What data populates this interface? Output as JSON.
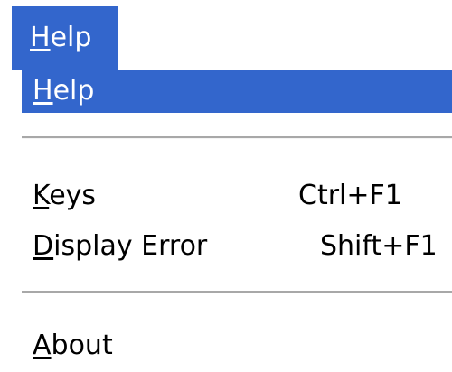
{
  "theme": {
    "selection_bg": "#3366cc",
    "selection_fg": "#ffffff",
    "text": "#000000",
    "separator": "#a8a8a8"
  },
  "menubar": {
    "help": {
      "mnemonic": "H",
      "rest": "elp"
    }
  },
  "menu": {
    "items": [
      {
        "mnemonic": "H",
        "rest": "elp",
        "shortcut": "",
        "selected": true
      },
      {
        "mnemonic": "K",
        "rest": "eys",
        "shortcut": "Ctrl+F1",
        "selected": false
      },
      {
        "mnemonic": "D",
        "rest": "isplay Error",
        "shortcut": "Shift+F1",
        "selected": false
      },
      {
        "mnemonic": "A",
        "rest": "bout",
        "shortcut": "",
        "selected": false
      }
    ]
  }
}
